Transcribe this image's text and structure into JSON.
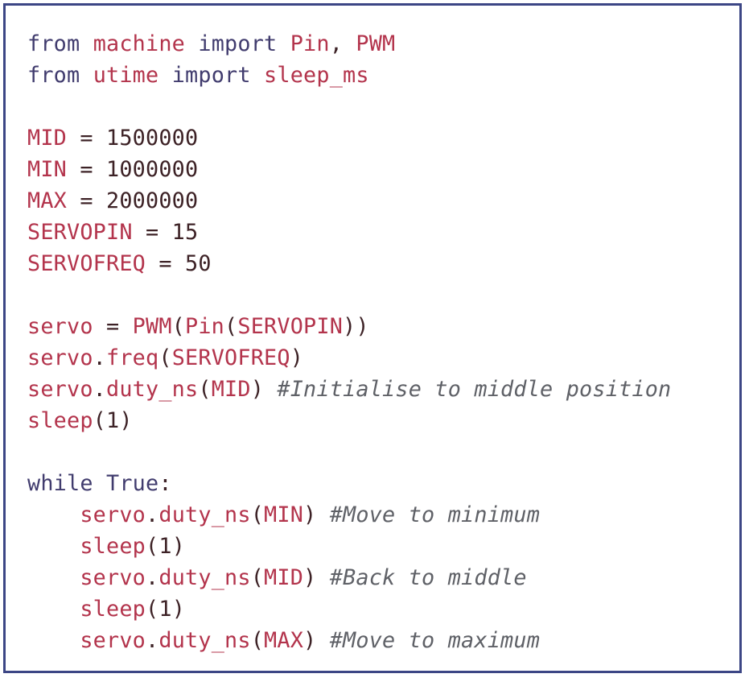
{
  "colors": {
    "frame_border": "#3c4685",
    "keyword": "#413c6e",
    "identifier": "#b3344c",
    "number": "#3d2226",
    "comment": "#5f6167"
  },
  "lines": [
    [
      {
        "t": "from",
        "c": "kw"
      },
      {
        "t": " ",
        "c": "op"
      },
      {
        "t": "machine",
        "c": "id"
      },
      {
        "t": " ",
        "c": "op"
      },
      {
        "t": "import",
        "c": "kw"
      },
      {
        "t": " ",
        "c": "op"
      },
      {
        "t": "Pin",
        "c": "id"
      },
      {
        "t": ", ",
        "c": "op"
      },
      {
        "t": "PWM",
        "c": "id"
      }
    ],
    [
      {
        "t": "from",
        "c": "kw"
      },
      {
        "t": " ",
        "c": "op"
      },
      {
        "t": "utime",
        "c": "id"
      },
      {
        "t": " ",
        "c": "op"
      },
      {
        "t": "import",
        "c": "kw"
      },
      {
        "t": " ",
        "c": "op"
      },
      {
        "t": "sleep_ms",
        "c": "id"
      }
    ],
    [],
    [
      {
        "t": "MID",
        "c": "id"
      },
      {
        "t": " = ",
        "c": "op"
      },
      {
        "t": "1500000",
        "c": "num"
      }
    ],
    [
      {
        "t": "MIN",
        "c": "id"
      },
      {
        "t": " = ",
        "c": "op"
      },
      {
        "t": "1000000",
        "c": "num"
      }
    ],
    [
      {
        "t": "MAX",
        "c": "id"
      },
      {
        "t": " = ",
        "c": "op"
      },
      {
        "t": "2000000",
        "c": "num"
      }
    ],
    [
      {
        "t": "SERVOPIN",
        "c": "id"
      },
      {
        "t": " = ",
        "c": "op"
      },
      {
        "t": "15",
        "c": "num"
      }
    ],
    [
      {
        "t": "SERVOFREQ",
        "c": "id"
      },
      {
        "t": " = ",
        "c": "op"
      },
      {
        "t": "50",
        "c": "num"
      }
    ],
    [],
    [
      {
        "t": "servo",
        "c": "id"
      },
      {
        "t": " = ",
        "c": "op"
      },
      {
        "t": "PWM",
        "c": "id"
      },
      {
        "t": "(",
        "c": "op"
      },
      {
        "t": "Pin",
        "c": "id"
      },
      {
        "t": "(",
        "c": "op"
      },
      {
        "t": "SERVOPIN",
        "c": "id"
      },
      {
        "t": "))",
        "c": "op"
      }
    ],
    [
      {
        "t": "servo",
        "c": "id"
      },
      {
        "t": ".",
        "c": "op"
      },
      {
        "t": "freq",
        "c": "id"
      },
      {
        "t": "(",
        "c": "op"
      },
      {
        "t": "SERVOFREQ",
        "c": "id"
      },
      {
        "t": ")",
        "c": "op"
      }
    ],
    [
      {
        "t": "servo",
        "c": "id"
      },
      {
        "t": ".",
        "c": "op"
      },
      {
        "t": "duty_ns",
        "c": "id"
      },
      {
        "t": "(",
        "c": "op"
      },
      {
        "t": "MID",
        "c": "id"
      },
      {
        "t": ") ",
        "c": "op"
      },
      {
        "t": "#Initialise to middle position",
        "c": "cm"
      }
    ],
    [
      {
        "t": "sleep",
        "c": "id"
      },
      {
        "t": "(",
        "c": "op"
      },
      {
        "t": "1",
        "c": "num"
      },
      {
        "t": ")",
        "c": "op"
      }
    ],
    [],
    [
      {
        "t": "while",
        "c": "kw"
      },
      {
        "t": " ",
        "c": "op"
      },
      {
        "t": "True",
        "c": "kw"
      },
      {
        "t": ":",
        "c": "op"
      }
    ],
    [
      {
        "t": "    ",
        "c": "op"
      },
      {
        "t": "servo",
        "c": "id"
      },
      {
        "t": ".",
        "c": "op"
      },
      {
        "t": "duty_ns",
        "c": "id"
      },
      {
        "t": "(",
        "c": "op"
      },
      {
        "t": "MIN",
        "c": "id"
      },
      {
        "t": ") ",
        "c": "op"
      },
      {
        "t": "#Move to minimum",
        "c": "cm"
      }
    ],
    [
      {
        "t": "    ",
        "c": "op"
      },
      {
        "t": "sleep",
        "c": "id"
      },
      {
        "t": "(",
        "c": "op"
      },
      {
        "t": "1",
        "c": "num"
      },
      {
        "t": ")",
        "c": "op"
      }
    ],
    [
      {
        "t": "    ",
        "c": "op"
      },
      {
        "t": "servo",
        "c": "id"
      },
      {
        "t": ".",
        "c": "op"
      },
      {
        "t": "duty_ns",
        "c": "id"
      },
      {
        "t": "(",
        "c": "op"
      },
      {
        "t": "MID",
        "c": "id"
      },
      {
        "t": ") ",
        "c": "op"
      },
      {
        "t": "#Back to middle",
        "c": "cm"
      }
    ],
    [
      {
        "t": "    ",
        "c": "op"
      },
      {
        "t": "sleep",
        "c": "id"
      },
      {
        "t": "(",
        "c": "op"
      },
      {
        "t": "1",
        "c": "num"
      },
      {
        "t": ")",
        "c": "op"
      }
    ],
    [
      {
        "t": "    ",
        "c": "op"
      },
      {
        "t": "servo",
        "c": "id"
      },
      {
        "t": ".",
        "c": "op"
      },
      {
        "t": "duty_ns",
        "c": "id"
      },
      {
        "t": "(",
        "c": "op"
      },
      {
        "t": "MAX",
        "c": "id"
      },
      {
        "t": ") ",
        "c": "op"
      },
      {
        "t": "#Move to maximum",
        "c": "cm"
      }
    ]
  ]
}
